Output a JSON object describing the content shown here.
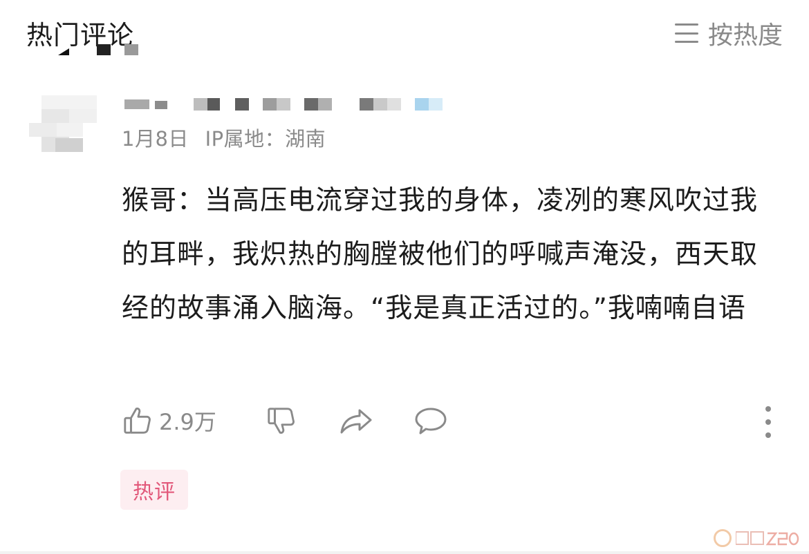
{
  "header": {
    "title": "热门评论",
    "sort_label": "按热度"
  },
  "comment": {
    "date": "1月8日",
    "ip_location": "IP属地：湖南",
    "text": "猴哥：当高压电流穿过我的身体，凌冽的寒风吹过我的耳畔，我炽热的胸膛被他们的呼喊声淹没，西天取经的故事涌入脑海。“我是真正活过的。”我喃喃自语",
    "like_count": "2.9万",
    "badge": "热评"
  },
  "icons": {
    "sort": "menu-lines-icon",
    "like": "thumbs-up-icon",
    "dislike": "thumbs-down-icon",
    "share": "share-arrow-icon",
    "reply": "comment-bubble-icon",
    "more": "more-vertical-icon"
  },
  "colors": {
    "badge_text": "#e2587a",
    "badge_bg": "#fdeef1",
    "secondary_text": "#8a8a8a"
  }
}
